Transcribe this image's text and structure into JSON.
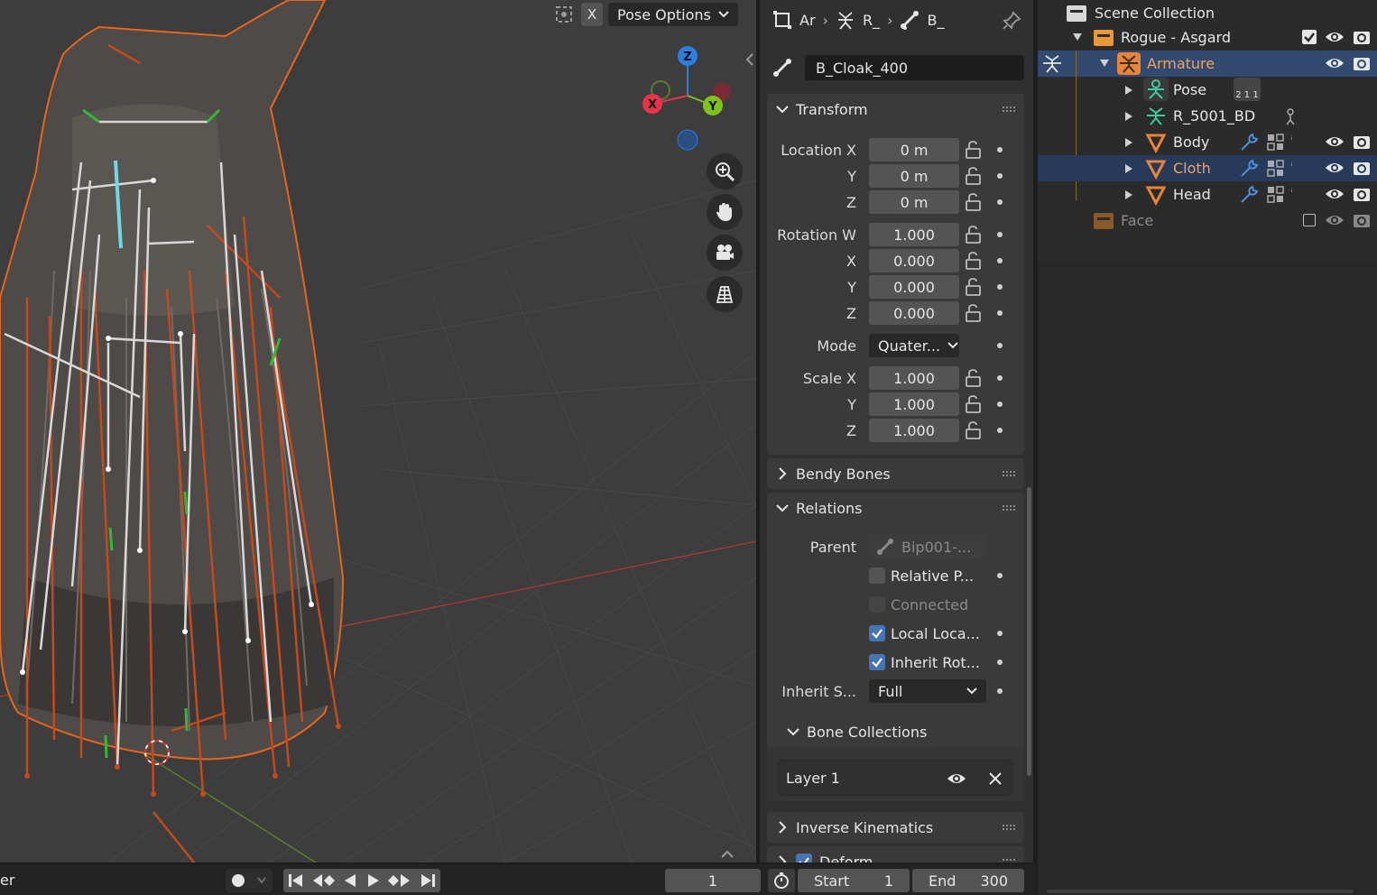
{
  "viewport": {
    "x_toggle": "X",
    "pose_options_label": "Pose Options",
    "gizmo": {
      "z": "Z",
      "x": "X",
      "y": "Y"
    },
    "nav_icons": [
      "zoom-icon",
      "hand-icon",
      "camera-icon",
      "grid-icon"
    ]
  },
  "properties": {
    "breadcrumb": [
      "Ar",
      "R_",
      "B_"
    ],
    "bone_name": "B_Cloak_400",
    "transform": {
      "title": "Transform",
      "location_label": "Location X",
      "location": [
        "0 m",
        "0 m",
        "0 m"
      ],
      "rotation_label": "Rotation W",
      "rotation": [
        "1.000",
        "0.000",
        "0.000",
        "0.000"
      ],
      "mode_label": "Mode",
      "mode_value": "Quater...",
      "scale_label": "Scale X",
      "scale": [
        "1.000",
        "1.000",
        "1.000"
      ],
      "axis_y": "Y",
      "axis_z": "Z",
      "axis_x": "X"
    },
    "bendy_bones": "Bendy Bones",
    "relations": {
      "title": "Relations",
      "parent_label": "Parent",
      "parent_value": "Bip001-...",
      "relative_parent": "Relative P...",
      "connected": "Connected",
      "local_location": "Local Loca...",
      "inherit_rotation": "Inherit Rot...",
      "inherit_scale_label": "Inherit S...",
      "inherit_scale_value": "Full"
    },
    "bone_collections": {
      "title": "Bone Collections",
      "layer": "Layer 1"
    },
    "inverse_kinematics": "Inverse Kinematics",
    "deform": "Deform"
  },
  "outliner": {
    "scene_collection": "Scene Collection",
    "items": [
      {
        "label": "Rogue - Asgard"
      },
      {
        "label": "Armature"
      },
      {
        "label": "Pose",
        "badge": "2 1 1"
      },
      {
        "label": "R_5001_BD"
      },
      {
        "label": "Body"
      },
      {
        "label": "Cloth"
      },
      {
        "label": "Head"
      },
      {
        "label": "Face"
      }
    ]
  },
  "timeline": {
    "left_text": "er",
    "current_frame": "1",
    "start_label": "Start",
    "start_value": "1",
    "end_label": "End",
    "end_value": "300"
  },
  "colors": {
    "accent_blue": "#4772b3",
    "orange": "#e8833a",
    "selected_row": "#334a70",
    "axis_x": "#e8334a",
    "axis_y": "#7ec31a",
    "axis_z": "#2a7fe0"
  }
}
